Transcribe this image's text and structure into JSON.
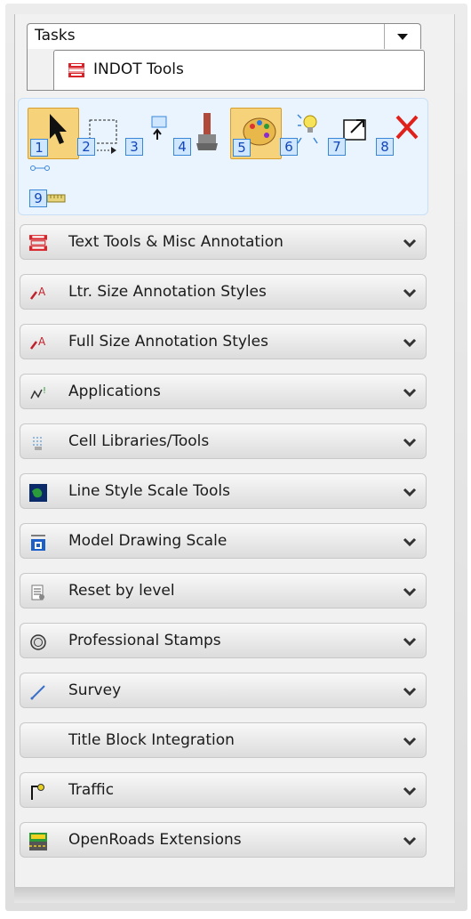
{
  "tasks_dropdown": {
    "label": "Tasks"
  },
  "active_tab": {
    "label": "INDOT Tools",
    "icon": "indot-logo-icon"
  },
  "toolbox": {
    "tools": [
      {
        "num": "1",
        "icon": "select-arrow-icon",
        "active": true
      },
      {
        "num": "2",
        "icon": "fence-icon",
        "active": false
      },
      {
        "num": "3",
        "icon": "move-element-icon",
        "active": false
      },
      {
        "num": "4",
        "icon": "paint-brush-icon",
        "active": false
      },
      {
        "num": "5",
        "icon": "palette-icon",
        "active": true
      },
      {
        "num": "6",
        "icon": "idea-bulb-icon",
        "active": false
      },
      {
        "num": "7",
        "icon": "scale-box-icon",
        "active": false
      },
      {
        "num": "8",
        "icon": "delete-x-icon",
        "active": false
      },
      {
        "num": "9",
        "icon": "measure-icon",
        "active": false
      }
    ]
  },
  "sections": [
    {
      "label": "Text Tools & Misc Annotation",
      "icon": "indot-logo-icon"
    },
    {
      "label": "Ltr. Size Annotation Styles",
      "icon": "text-style-icon"
    },
    {
      "label": "Full Size Annotation Styles",
      "icon": "text-style-icon"
    },
    {
      "label": "Applications",
      "icon": "applications-icon"
    },
    {
      "label": "Cell Libraries/Tools",
      "icon": "cell-library-icon"
    },
    {
      "label": "Line Style Scale Tools",
      "icon": "globe-icon"
    },
    {
      "label": "Model Drawing Scale",
      "icon": "drawing-scale-icon"
    },
    {
      "label": "Reset by level",
      "icon": "reset-level-icon"
    },
    {
      "label": "Professional Stamps",
      "icon": "stamp-icon"
    },
    {
      "label": "Survey",
      "icon": "survey-line-icon"
    },
    {
      "label": "Title Block Integration",
      "icon": ""
    },
    {
      "label": "Traffic",
      "icon": "traffic-signal-icon"
    },
    {
      "label": "OpenRoads Extensions",
      "icon": "road-icon"
    }
  ],
  "colors": {
    "active_tool_bg": "#f6d27a",
    "toolbox_bg": "#eaf4ff",
    "indot_red": "#d8232a"
  }
}
